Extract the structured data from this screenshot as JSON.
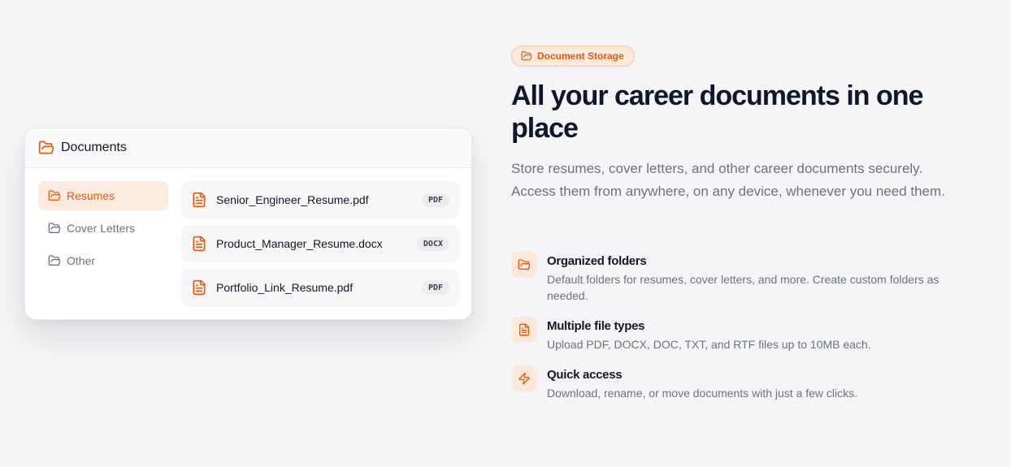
{
  "colors": {
    "accent": "#ea580c",
    "accent_soft": "#fde8dc",
    "text_primary": "#111827",
    "text_muted": "#6b7280",
    "background": "#f5f5f7"
  },
  "documents_card": {
    "title": "Documents",
    "title_icon": "folder-open-icon",
    "folders": [
      {
        "label": "Resumes",
        "icon": "folder-open-icon",
        "active": true
      },
      {
        "label": "Cover Letters",
        "icon": "folder-icon",
        "active": false
      },
      {
        "label": "Other",
        "icon": "folder-icon",
        "active": false
      }
    ],
    "files": [
      {
        "name": "Senior_Engineer_Resume.pdf",
        "type": "PDF",
        "icon": "file-text-icon"
      },
      {
        "name": "Product_Manager_Resume.docx",
        "type": "DOCX",
        "icon": "file-text-icon"
      },
      {
        "name": "Portfolio_Link_Resume.pdf",
        "type": "PDF",
        "icon": "file-text-icon"
      }
    ]
  },
  "hero": {
    "badge_label": "Document Storage",
    "badge_icon": "folder-open-icon",
    "headline": "All your career documents in one place",
    "lead": "Store resumes, cover letters, and other career documents securely. Access them from anywhere, on any device, whenever you need them."
  },
  "features": [
    {
      "icon": "folder-open-icon",
      "title": "Organized folders",
      "description": "Default folders for resumes, cover letters, and more. Create custom folders as needed."
    },
    {
      "icon": "file-text-icon",
      "title": "Multiple file types",
      "description": "Upload PDF, DOCX, DOC, TXT, and RTF files up to 10MB each."
    },
    {
      "icon": "zap-icon",
      "title": "Quick access",
      "description": "Download, rename, or move documents with just a few clicks."
    }
  ]
}
